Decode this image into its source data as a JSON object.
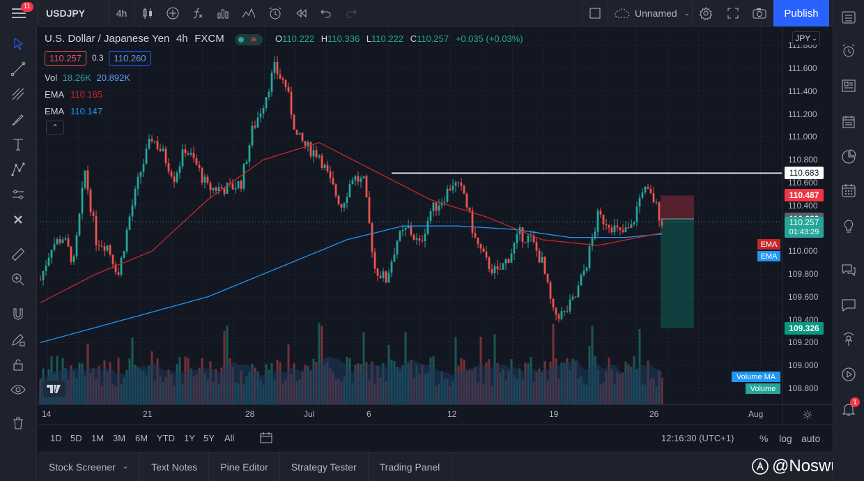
{
  "toolbar": {
    "menu_badge": "11",
    "symbol": "USDJPY",
    "interval": "4h",
    "layout_name": "Unnamed",
    "publish_label": "Publish"
  },
  "legend": {
    "title": "U.S. Dollar / Japanese Yen",
    "interval": "4h",
    "exchange": "FXCM",
    "open_label": "O",
    "open": "110.222",
    "high_label": "H",
    "high": "110.336",
    "low_label": "L",
    "low": "110.222",
    "close_label": "C",
    "close": "110.257",
    "change": "+0.035 (+0.03%)",
    "bid": "110.257",
    "spread": "0.3",
    "ask": "110.260",
    "vol_label": "Vol",
    "vol_value": "18.26K",
    "vol_ma": "20.892K",
    "ema1_label": "EMA",
    "ema1_value": "110.165",
    "ema2_label": "EMA",
    "ema2_value": "110.147"
  },
  "price_axis": {
    "currency": "JPY",
    "ticks": [
      "111.800",
      "111.600",
      "111.400",
      "111.200",
      "111.000",
      "110.800",
      "110.600",
      "110.400",
      "110.200",
      "110.000",
      "109.800",
      "109.600",
      "109.400",
      "109.200",
      "109.000",
      "108.800"
    ],
    "badges": {
      "line_level": "110.683",
      "stop_level": "110.487",
      "entry_level": "110.282",
      "last_price": "110.257",
      "countdown": "01:43:29",
      "target_level": "109.326",
      "ema_red": "EMA",
      "ema_blue": "EMA",
      "volume_ma": "Volume MA",
      "volume": "Volume"
    }
  },
  "time_axis": {
    "ticks": [
      "14",
      "21",
      "28",
      "Jul",
      "6",
      "12",
      "19",
      "26",
      "Aug"
    ]
  },
  "range_bar": {
    "ranges": [
      "1D",
      "5D",
      "1M",
      "3M",
      "6M",
      "YTD",
      "1Y",
      "5Y",
      "All"
    ],
    "clock": "12:16:30 (UTC+1)",
    "percent": "%",
    "log": "log",
    "auto": "auto"
  },
  "bottom_panel": {
    "tabs": [
      "Stock Screener",
      "Text Notes",
      "Pine Editor",
      "Strategy Tester",
      "Trading Panel"
    ]
  },
  "watermark": "@Noswus",
  "sidebar": {
    "alert_badge": "1"
  },
  "colors": {
    "up": "#26a69a",
    "down": "#ef5350",
    "ema_red": "#c62828",
    "ema_blue": "#2196f3",
    "accent": "#2962ff"
  },
  "chart_data": {
    "type": "candlestick",
    "symbol": "USDJPY",
    "interval": "4h",
    "ylim": [
      108.7,
      111.9
    ],
    "x_ticks": [
      "14",
      "21",
      "28",
      "Jul",
      "6",
      "12",
      "19",
      "26",
      "Aug"
    ],
    "close_path": [
      [
        0,
        109.75
      ],
      [
        4,
        110.05
      ],
      [
        8,
        110.12
      ],
      [
        12,
        109.9
      ],
      [
        16,
        110.7
      ],
      [
        20,
        110.1
      ],
      [
        24,
        110.05
      ],
      [
        28,
        109.8
      ],
      [
        32,
        110.3
      ],
      [
        36,
        110.7
      ],
      [
        40,
        111.0
      ],
      [
        44,
        110.85
      ],
      [
        48,
        110.65
      ],
      [
        52,
        110.9
      ],
      [
        56,
        110.75
      ],
      [
        60,
        110.55
      ],
      [
        64,
        110.55
      ],
      [
        68,
        110.55
      ],
      [
        72,
        110.6
      ],
      [
        76,
        111.05
      ],
      [
        80,
        111.3
      ],
      [
        84,
        111.6
      ],
      [
        88,
        111.45
      ],
      [
        92,
        111.0
      ],
      [
        96,
        110.9
      ],
      [
        100,
        110.85
      ],
      [
        104,
        110.6
      ],
      [
        108,
        110.4
      ],
      [
        112,
        110.65
      ],
      [
        116,
        110.6
      ],
      [
        120,
        109.85
      ],
      [
        124,
        109.75
      ],
      [
        128,
        110.1
      ],
      [
        132,
        110.2
      ],
      [
        136,
        110.05
      ],
      [
        140,
        110.35
      ],
      [
        144,
        110.45
      ],
      [
        148,
        110.6
      ],
      [
        152,
        110.5
      ],
      [
        156,
        110.1
      ],
      [
        160,
        109.9
      ],
      [
        164,
        109.8
      ],
      [
        168,
        109.95
      ],
      [
        172,
        110.15
      ],
      [
        176,
        110.1
      ],
      [
        180,
        109.9
      ],
      [
        184,
        109.45
      ],
      [
        188,
        109.45
      ],
      [
        192,
        109.6
      ],
      [
        196,
        109.9
      ],
      [
        200,
        110.3
      ],
      [
        204,
        110.25
      ],
      [
        208,
        110.15
      ],
      [
        212,
        110.2
      ],
      [
        216,
        110.55
      ],
      [
        220,
        110.45
      ],
      [
        223,
        110.26
      ]
    ],
    "ema_red_path": [
      [
        0,
        109.55
      ],
      [
        20,
        109.8
      ],
      [
        40,
        110.0
      ],
      [
        60,
        110.45
      ],
      [
        80,
        110.8
      ],
      [
        100,
        110.95
      ],
      [
        120,
        110.7
      ],
      [
        140,
        110.45
      ],
      [
        160,
        110.3
      ],
      [
        180,
        110.1
      ],
      [
        200,
        110.05
      ],
      [
        223,
        110.16
      ]
    ],
    "ema_blue_path": [
      [
        0,
        109.2
      ],
      [
        30,
        109.4
      ],
      [
        60,
        109.6
      ],
      [
        90,
        109.9
      ],
      [
        110,
        110.1
      ],
      [
        130,
        110.22
      ],
      [
        150,
        110.22
      ],
      [
        170,
        110.19
      ],
      [
        190,
        110.12
      ],
      [
        210,
        110.12
      ],
      [
        223,
        110.15
      ]
    ],
    "horizontal_line": 110.683,
    "position": {
      "entry": 110.282,
      "stop": 110.487,
      "target": 109.326
    },
    "last_price": 110.257
  }
}
